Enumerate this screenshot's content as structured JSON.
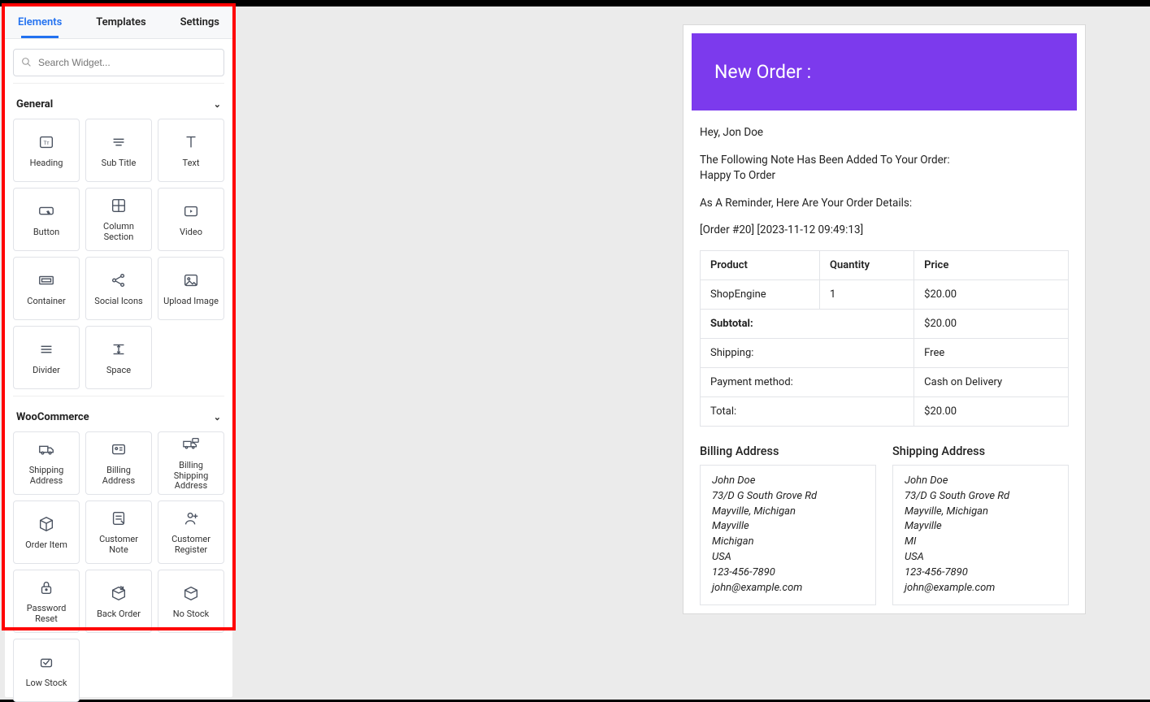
{
  "tabs": {
    "elements": "Elements",
    "templates": "Templates",
    "settings": "Settings"
  },
  "search": {
    "placeholder": "Search Widget..."
  },
  "sections": {
    "general": {
      "title": "General",
      "widgets": [
        {
          "key": "heading",
          "label": "Heading"
        },
        {
          "key": "subtitle",
          "label": "Sub Title"
        },
        {
          "key": "text",
          "label": "Text"
        },
        {
          "key": "button",
          "label": "Button"
        },
        {
          "key": "column-section",
          "label": "Column Section"
        },
        {
          "key": "video",
          "label": "Video"
        },
        {
          "key": "container",
          "label": "Container"
        },
        {
          "key": "social-icons",
          "label": "Social Icons"
        },
        {
          "key": "upload-image",
          "label": "Upload Image"
        },
        {
          "key": "divider",
          "label": "Divider"
        },
        {
          "key": "space",
          "label": "Space"
        }
      ]
    },
    "woocommerce": {
      "title": "WooCommerce",
      "widgets": [
        {
          "key": "shipping-address",
          "label": "Shipping Address"
        },
        {
          "key": "billing-address",
          "label": "Billing Address"
        },
        {
          "key": "billing-shipping-address",
          "label": "Billing Shipping Address"
        },
        {
          "key": "order-item",
          "label": "Order Item"
        },
        {
          "key": "customer-note",
          "label": "Customer Note"
        },
        {
          "key": "customer-register",
          "label": "Customer Register"
        },
        {
          "key": "password-reset",
          "label": "Password Reset"
        },
        {
          "key": "back-order",
          "label": "Back Order"
        },
        {
          "key": "no-stock",
          "label": "No Stock"
        }
      ]
    },
    "extra": {
      "widgets": [
        {
          "key": "low-stock",
          "label": "Low Stock"
        }
      ]
    }
  },
  "preview": {
    "hero": "New Order :",
    "greeting": "Hey, Jon Doe",
    "note_intro": "The Following Note Has Been Added To Your Order:",
    "note_body": "Happy To Order",
    "reminder": "As A Reminder, Here Are Your Order Details:",
    "order_meta": "[Order #20] [2023-11-12 09:49:13]",
    "table": {
      "headers": {
        "product": "Product",
        "quantity": "Quantity",
        "price": "Price"
      },
      "rows": [
        {
          "product": "ShopEngine",
          "quantity": "1",
          "price": "$20.00"
        }
      ],
      "totals": [
        {
          "label": "Subtotal:",
          "value": "$20.00",
          "bold": true
        },
        {
          "label": "Shipping:",
          "value": "Free"
        },
        {
          "label": "Payment method:",
          "value": "Cash on Delivery"
        },
        {
          "label": "Total:",
          "value": "$20.00"
        }
      ]
    },
    "billing": {
      "title": "Billing Address",
      "lines": [
        "John Doe",
        "73/D G South Grove Rd",
        "Mayville, Michigan",
        "Mayville",
        "Michigan",
        "USA",
        "123-456-7890",
        "john@example.com"
      ]
    },
    "shipping": {
      "title": "Shipping Address",
      "lines": [
        "John Doe",
        "73/D G South Grove Rd",
        "Mayville, Michigan",
        "Mayville",
        "MI",
        "USA",
        "123-456-7890",
        "john@example.com"
      ]
    }
  },
  "icons": {
    "heading": "heading-icon",
    "subtitle": "subtitle-icon",
    "text": "text-icon",
    "button": "button-icon",
    "column-section": "grid-icon",
    "video": "video-icon",
    "container": "container-icon",
    "social-icons": "share-icon",
    "upload-image": "image-icon",
    "divider": "divider-icon",
    "space": "space-icon",
    "shipping-address": "truck-icon",
    "billing-address": "card-icon",
    "billing-shipping-address": "truck-card-icon",
    "order-item": "box-icon",
    "customer-note": "note-icon",
    "customer-register": "user-plus-icon",
    "password-reset": "lock-icon",
    "back-order": "box-reload-icon",
    "no-stock": "box-x-icon",
    "low-stock": "box-low-icon"
  }
}
